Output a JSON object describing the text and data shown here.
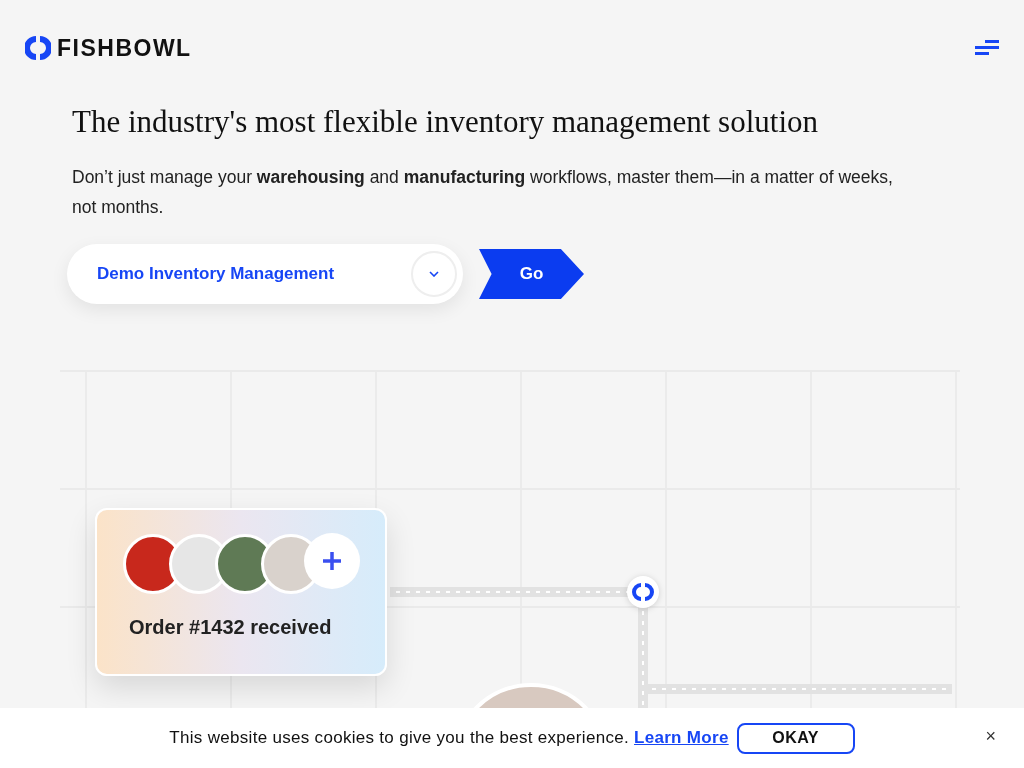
{
  "header": {
    "logo": "FISHBOWL"
  },
  "hero": {
    "title": "The industry's most flexible inventory management solution",
    "description": "Don’t just manage your **warehousing** and **manufacturing** workflows, master them—in a matter of weeks, not months.",
    "select": {
      "value": "Demo Inventory Management"
    },
    "go_button": "Go"
  },
  "illustration": {
    "order_card": {
      "label": "Order #1432 received"
    }
  },
  "cookie_bar": {
    "message": "This website uses cookies to give you the best experience.",
    "link": "Learn More",
    "button": "OKAY",
    "close": "×"
  }
}
